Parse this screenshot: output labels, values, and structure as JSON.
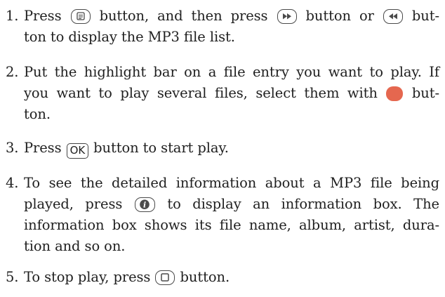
{
  "steps": [
    {
      "number": "1.",
      "line1_a": "Press",
      "line1_b": "button, and then press",
      "line1_c": "button or",
      "line1_d": "but-",
      "line2": "ton to display the MP3 file list.",
      "icons": [
        "menu-button-icon",
        "fast-forward-button-icon",
        "rewind-button-icon"
      ]
    },
    {
      "number": "2.",
      "line1": "Put the highlight bar on a file entry you want to play. If",
      "line2_a": "you want to play several files, select them with",
      "line2_b": "but-",
      "line3": "ton.",
      "icons": [
        "red-button-icon"
      ],
      "red_button_color": "#e5674f"
    },
    {
      "number": "3.",
      "text_a": "Press",
      "ok_label": "OK",
      "text_b": "button to start play."
    },
    {
      "number": "4.",
      "line1": "To see the detailed information about a MP3 file being",
      "line2_a": "played, press",
      "line2_b": "to display an information box.  The",
      "line3": "information box shows its file name, album, artist, dura-",
      "line4": "tion and so on.",
      "icons": [
        "info-button-icon"
      ]
    },
    {
      "number": "5.",
      "text_a": "To stop play, press",
      "text_b": "button.",
      "icons": [
        "stop-button-icon"
      ]
    }
  ]
}
